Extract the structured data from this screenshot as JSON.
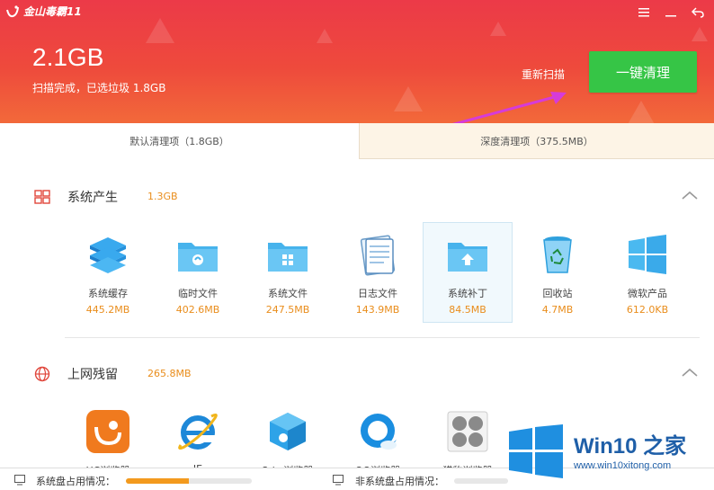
{
  "app": {
    "title": "金山毒霸11",
    "scan_size": "2.1GB",
    "scan_status": "扫描完成，已选垃圾 1.8GB",
    "rescan_label": "重新扫描",
    "clean_label": "一键清理",
    "window_controls": [
      "menu-icon",
      "minimize-icon",
      "back-icon"
    ]
  },
  "tabs": [
    {
      "label": "默认清理项（1.8GB）",
      "active": true
    },
    {
      "label": "深度清理项（375.5MB）",
      "active": false
    }
  ],
  "sections": [
    {
      "title": "系统产生",
      "size": "1.3GB",
      "icon": "windows-logo-icon",
      "items": [
        {
          "name": "系统缓存",
          "size": "445.2MB",
          "icon": "stack-icon"
        },
        {
          "name": "临时文件",
          "size": "402.6MB",
          "icon": "temp-folder-icon"
        },
        {
          "name": "系统文件",
          "size": "247.5MB",
          "icon": "system-folder-icon"
        },
        {
          "name": "日志文件",
          "size": "143.9MB",
          "icon": "notepad-icon"
        },
        {
          "name": "系统补丁",
          "size": "84.5MB",
          "icon": "patch-folder-icon",
          "selected": true
        },
        {
          "name": "回收站",
          "size": "4.7MB",
          "icon": "recycle-bin-icon"
        },
        {
          "name": "微软产品",
          "size": "612.0KB",
          "icon": "windows-tile-icon"
        }
      ]
    },
    {
      "title": "上网残留",
      "size": "265.8MB",
      "icon": "globe-icon",
      "items": [
        {
          "name": "UC浏览器",
          "icon": "uc-browser-icon"
        },
        {
          "name": "IE",
          "icon": "ie-icon"
        },
        {
          "name": "2dc 浏览器",
          "icon": "cube-browser-icon"
        },
        {
          "name": "QQ浏览器",
          "icon": "qq-browser-icon"
        },
        {
          "name": "猎豹浏览器",
          "icon": "cheetah-browser-icon"
        }
      ]
    }
  ],
  "status": {
    "system_disk_label": "系统盘占用情况：",
    "system_disk_fill": 0.5,
    "other_disk_label": "非系统盘占用情况：",
    "other_disk_fill": 0.0
  },
  "watermark": {
    "brand": "Win10 之家",
    "url": "www.win10xitong.com"
  },
  "colors": {
    "header_red": "#ec3a48",
    "clean_green": "#36c546",
    "size_orange": "#e98d1c",
    "arrow_magenta": "#d63bd9"
  }
}
